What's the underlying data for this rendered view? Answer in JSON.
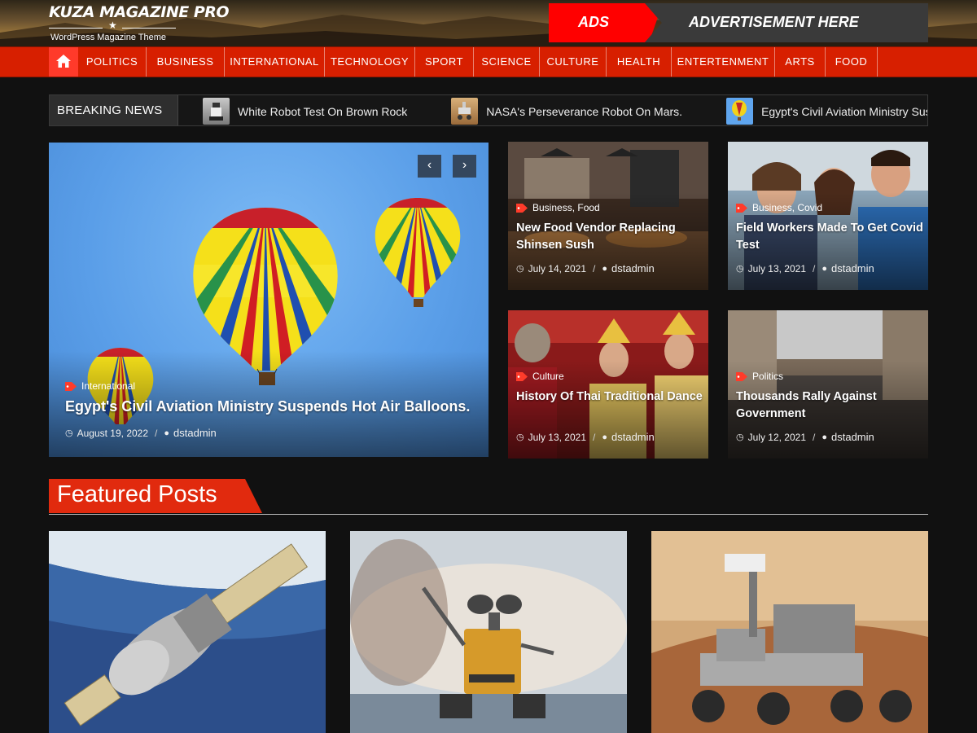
{
  "header": {
    "logo_name": "KUZA MAGAZINE PRO",
    "logo_tagline": "WordPress Magazine Theme",
    "ads_label": "ADS",
    "ads_text": "ADVERTISEMENT HERE"
  },
  "nav": {
    "home_icon": "home-icon",
    "items": [
      "POLITICS",
      "BUSINESS",
      "INTERNATIONAL",
      "TECHNOLOGY",
      "SPORT",
      "SCIENCE",
      "CULTURE",
      "HEALTH",
      "ENTERTENMENT",
      "ARTS",
      "FOOD"
    ]
  },
  "breaking": {
    "label": "BREAKING NEWS",
    "items": [
      "White Robot Test On Brown Rock",
      "NASA's Perseverance Robot On Mars.",
      "Egypt's Civil Aviation Ministry Suspends Hot Air Balloons."
    ]
  },
  "slider": {
    "category": "International",
    "title": "Egypt's Civil Aviation Ministry Suspends Hot Air Balloons.",
    "date": "August 19, 2022",
    "author": "dstadmin",
    "prev": "‹",
    "next": "›"
  },
  "tiles": [
    {
      "category": "Business, Food",
      "title": "New Food Vendor Replacing Shinsen Sush",
      "date": "July 14, 2021",
      "author": "dstadmin"
    },
    {
      "category": "Business, Covid",
      "title": "Field Workers Made To Get Covid Test",
      "date": "July 13, 2021",
      "author": "dstadmin"
    },
    {
      "category": "Culture",
      "title": "History Of Thai Traditional Dance",
      "date": "July 13, 2021",
      "author": "dstadmin"
    },
    {
      "category": "Politics",
      "title": "Thousands Rally Against Government",
      "date": "July 12, 2021",
      "author": "dstadmin"
    }
  ],
  "featured": {
    "heading": "Featured Posts"
  },
  "colors": {
    "brand_red": "#d71f00",
    "ads_red": "#ff0000",
    "background": "#111111"
  }
}
